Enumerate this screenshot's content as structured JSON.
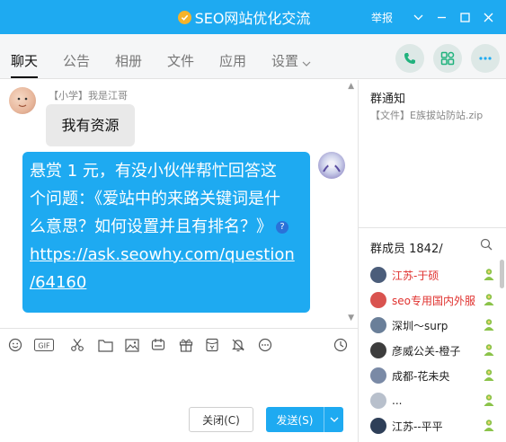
{
  "window": {
    "title": "SEO网站优化交流",
    "report_label": "举报"
  },
  "tabs": [
    {
      "label": "聊天"
    },
    {
      "label": "公告"
    },
    {
      "label": "相册"
    },
    {
      "label": "文件"
    },
    {
      "label": "应用"
    },
    {
      "label": "设置"
    }
  ],
  "chat": {
    "messages": [
      {
        "sender": "【小学】我是江哥",
        "text": "我有资源"
      },
      {
        "sender": "",
        "lines": [
          "悬赏 1 元，有没小伙伴帮忙回答这",
          "个问题：《爱站中的来路关键词是什",
          "么意思？如何设置并且有排名？》"
        ],
        "link_lines": [
          "https://ask.seowhy.com/question",
          "/64160"
        ]
      }
    ]
  },
  "input": {
    "close_label": "关闭(C)",
    "send_label": "发送(S)"
  },
  "sidebar": {
    "notice_title": "群通知",
    "notice_text": "【文件】E族拔站防站.zip",
    "members_title": "群成员 1842/",
    "members": [
      {
        "name": "江苏-于硕",
        "highlight": true
      },
      {
        "name": "seo专用国内外服",
        "highlight": true
      },
      {
        "name": "深圳～surp",
        "highlight": false
      },
      {
        "name": "彦威公关-橙子",
        "highlight": false
      },
      {
        "name": "成都-花未央",
        "highlight": false
      },
      {
        "name": "...",
        "highlight": false
      },
      {
        "name": "江苏--平平",
        "highlight": false
      }
    ]
  },
  "colors": {
    "accent": "#1eaaf1",
    "highlight_name": "#e0322f"
  }
}
